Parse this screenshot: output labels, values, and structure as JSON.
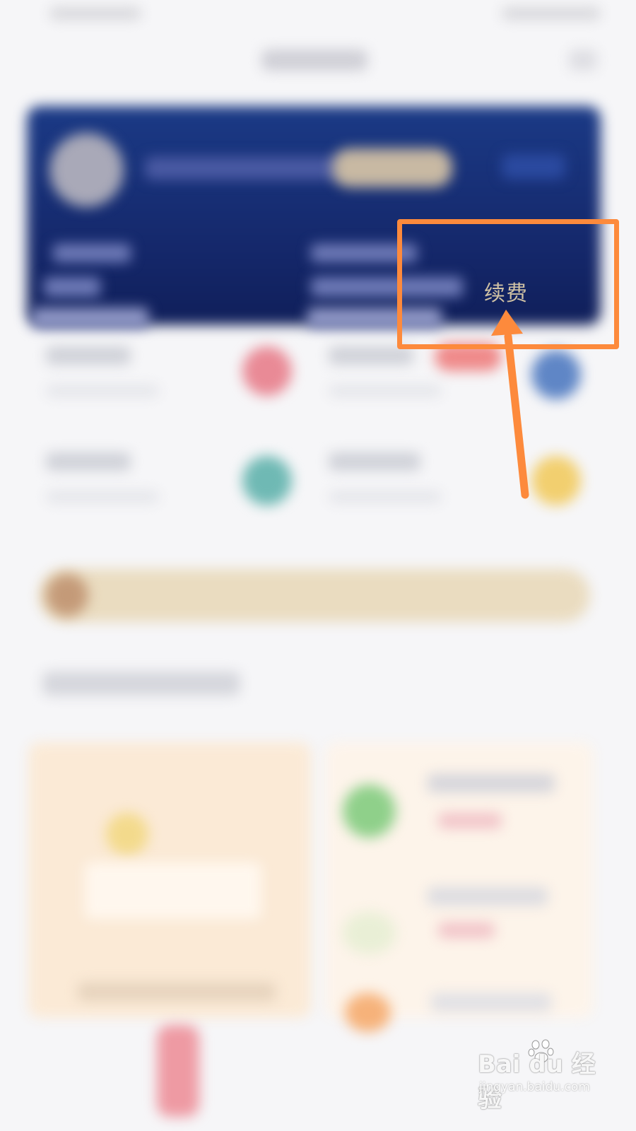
{
  "card": {
    "renew_label": "续费"
  },
  "watermark": {
    "brand": "Bai du 经验",
    "domain": "jingyan.baidu.com"
  },
  "colors": {
    "card_blue": "#15286b",
    "renew_gold": "#cfc1a4",
    "annotation_orange": "#fd8a3c",
    "service_red": "#e98a96",
    "service_blue": "#5f86c6",
    "service_teal": "#6fb9b4",
    "service_yellow": "#f2cf6f"
  },
  "icons": [
    "avatar",
    "service-red-icon",
    "service-blue-icon",
    "service-teal-icon",
    "service-yellow-icon",
    "baidu-paw-icon"
  ]
}
